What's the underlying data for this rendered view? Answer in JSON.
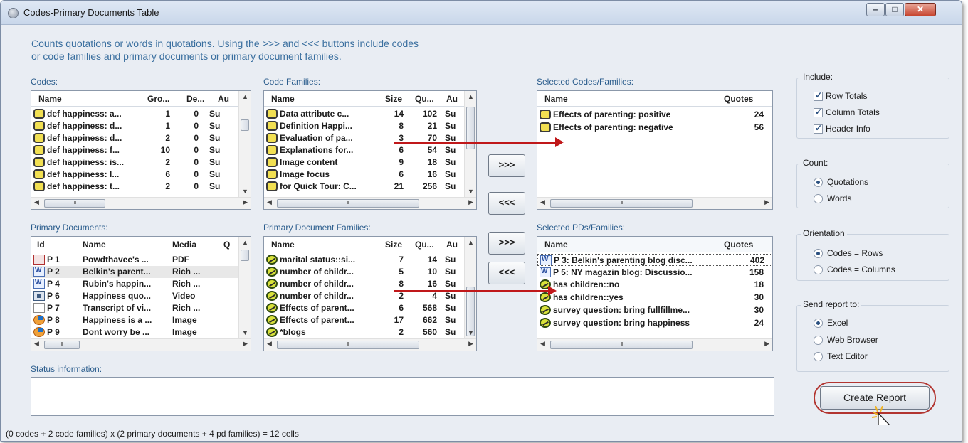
{
  "window": {
    "title": "Codes-Primary Documents Table",
    "description_line1": "Counts quotations or words in quotations. Using the >>> and <<< buttons  include codes",
    "description_line2": "or code families  and primary documents or primary document families."
  },
  "codes": {
    "label": "Codes:",
    "headers": [
      "Name",
      "Gro...",
      "De...",
      "Au"
    ],
    "rows": [
      {
        "name": "def happiness: a...",
        "gro": "1",
        "de": "0",
        "au": "Su"
      },
      {
        "name": "def happiness: d...",
        "gro": "1",
        "de": "0",
        "au": "Su"
      },
      {
        "name": "def happiness: d...",
        "gro": "2",
        "de": "0",
        "au": "Su"
      },
      {
        "name": "def happiness: f...",
        "gro": "10",
        "de": "0",
        "au": "Su"
      },
      {
        "name": "def happiness: is...",
        "gro": "2",
        "de": "0",
        "au": "Su"
      },
      {
        "name": "def happiness: l...",
        "gro": "6",
        "de": "0",
        "au": "Su"
      },
      {
        "name": "def happiness: t...",
        "gro": "2",
        "de": "0",
        "au": "Su"
      }
    ]
  },
  "code_families": {
    "label": "Code Families:",
    "headers": [
      "Name",
      "Size",
      "Qu...",
      "Au"
    ],
    "rows": [
      {
        "name": "Data attribute c...",
        "size": "14",
        "qu": "102",
        "au": "Su"
      },
      {
        "name": "Definition Happi...",
        "size": "8",
        "qu": "21",
        "au": "Su"
      },
      {
        "name": "Evaluation of pa...",
        "size": "3",
        "qu": "70",
        "au": "Su"
      },
      {
        "name": "Explanations for...",
        "size": "6",
        "qu": "54",
        "au": "Su"
      },
      {
        "name": "Image content",
        "size": "9",
        "qu": "18",
        "au": "Su"
      },
      {
        "name": "Image focus",
        "size": "6",
        "qu": "16",
        "au": "Su"
      },
      {
        "name": "for Quick Tour: C...",
        "size": "21",
        "qu": "256",
        "au": "Su"
      }
    ]
  },
  "selected_codes": {
    "label": "Selected Codes/Families:",
    "headers": [
      "Name",
      "Quotes"
    ],
    "rows": [
      {
        "name": "Effects of parenting: positive",
        "quotes": "24"
      },
      {
        "name": "Effects of parenting: negative",
        "quotes": "56"
      }
    ]
  },
  "primary_documents": {
    "label": "Primary Documents:",
    "headers": [
      "Id",
      "Name",
      "Media",
      "Q"
    ],
    "rows": [
      {
        "id": "P 1",
        "name": "Powdthavee's ...",
        "media": "PDF",
        "icon": "pdf-icon"
      },
      {
        "id": "P 2",
        "name": "Belkin's parent...",
        "media": "Rich ...",
        "icon": "word-doc-icon"
      },
      {
        "id": "P 4",
        "name": "Rubin's happin...",
        "media": "Rich ...",
        "icon": "word-doc-icon"
      },
      {
        "id": "P 6",
        "name": "Happiness quo...",
        "media": "Video",
        "icon": "video-icon"
      },
      {
        "id": "P 7",
        "name": "Transcript of vi...",
        "media": "Rich ...",
        "icon": "text-doc-icon"
      },
      {
        "id": "P 8",
        "name": "Happiness is a ...",
        "media": "Image",
        "icon": "image-icon"
      },
      {
        "id": "P 9",
        "name": "Dont worry be ...",
        "media": "Image",
        "icon": "image-icon"
      }
    ]
  },
  "pd_families": {
    "label": "Primary Document Families:",
    "headers": [
      "Name",
      "Size",
      "Qu...",
      "Au"
    ],
    "rows": [
      {
        "name": "marital status::si...",
        "size": "7",
        "qu": "14",
        "au": "Su"
      },
      {
        "name": "number of childr...",
        "size": "5",
        "qu": "10",
        "au": "Su"
      },
      {
        "name": "number of childr...",
        "size": "8",
        "qu": "16",
        "au": "Su"
      },
      {
        "name": "number of childr...",
        "size": "2",
        "qu": "4",
        "au": "Su"
      },
      {
        "name": "Effects of parent...",
        "size": "6",
        "qu": "568",
        "au": "Su"
      },
      {
        "name": "Effects of parent...",
        "size": "17",
        "qu": "662",
        "au": "Su"
      },
      {
        "name": "*blogs",
        "size": "2",
        "qu": "560",
        "au": "Su"
      }
    ]
  },
  "selected_pds": {
    "label": "Selected PDs/Families:",
    "headers": [
      "Name",
      "Quotes"
    ],
    "rows": [
      {
        "name": "P 3: Belkin's parenting blog disc...",
        "quotes": "402",
        "icon": "word-doc-icon"
      },
      {
        "name": "P 5: NY magazin blog: Discussio...",
        "quotes": "158",
        "icon": "word-doc-icon"
      },
      {
        "name": "has children::no",
        "quotes": "18",
        "icon": "family-icon"
      },
      {
        "name": "has children::yes",
        "quotes": "30",
        "icon": "family-icon"
      },
      {
        "name": "survey question: bring fullfillme...",
        "quotes": "30",
        "icon": "family-icon"
      },
      {
        "name": "survey question: bring happiness",
        "quotes": "24",
        "icon": "family-icon"
      }
    ]
  },
  "buttons": {
    "add": ">>>",
    "remove": "<<<",
    "create_report": "Create Report"
  },
  "include": {
    "title": "Include:",
    "options": [
      {
        "label": "Row Totals",
        "checked": true
      },
      {
        "label": "Column Totals",
        "checked": true
      },
      {
        "label": "Header Info",
        "checked": true
      }
    ]
  },
  "count": {
    "title": "Count:",
    "options": [
      {
        "label": "Quotations",
        "selected": true
      },
      {
        "label": "Words",
        "selected": false
      }
    ]
  },
  "orientation": {
    "title": "Orientation",
    "options": [
      {
        "label": "Codes = Rows",
        "selected": true
      },
      {
        "label": "Codes = Columns",
        "selected": false
      }
    ]
  },
  "send_report": {
    "title": "Send report to:",
    "options": [
      {
        "label": "Excel",
        "selected": true
      },
      {
        "label": "Web Browser",
        "selected": false
      },
      {
        "label": "Text Editor",
        "selected": false
      }
    ]
  },
  "status": {
    "label": "Status information:",
    "bar_text": "(0 codes + 2 code families) x (2 primary documents + 4 pd families) = 12 cells"
  }
}
